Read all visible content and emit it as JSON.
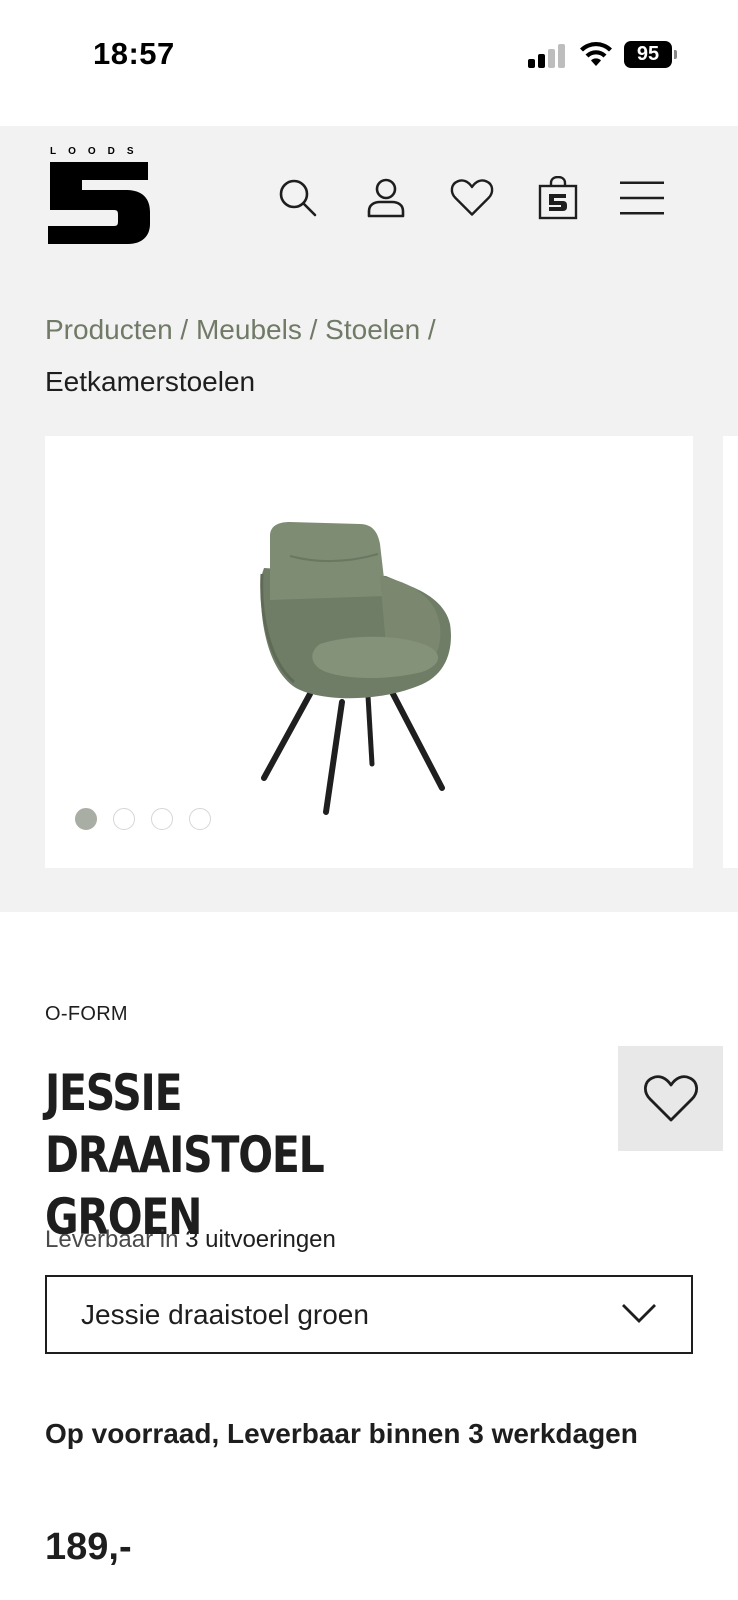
{
  "status_bar": {
    "time": "18:57",
    "battery": "95"
  },
  "header": {
    "logo_word": "LOODS",
    "logo_number": "5",
    "icons": [
      "search-icon",
      "account-icon",
      "heart-icon",
      "shopping-bag-icon",
      "menu-icon"
    ]
  },
  "breadcrumb": {
    "items": [
      "Producten",
      "Meubels",
      "Stoelen"
    ],
    "separator": "/",
    "current": "Eetkamerstoelen"
  },
  "gallery": {
    "image_count": 4,
    "active_index": 0
  },
  "product": {
    "brand": "O-FORM",
    "title": "JESSIE DRAAISTOEL GROEN",
    "variants_prefix": "Leverbaar in",
    "variants_count_text": "3 uitvoeringen",
    "selected_variant": "Jessie draaistoel groen",
    "stock": "Op voorraad, Leverbaar binnen 3 werkdagen",
    "price": "189,-"
  },
  "colors": {
    "background_grey": "#f2f2f2",
    "breadcrumb_link": "#707a66",
    "text_dark": "#1e1e1e",
    "chair_green": "#7d8a72"
  }
}
